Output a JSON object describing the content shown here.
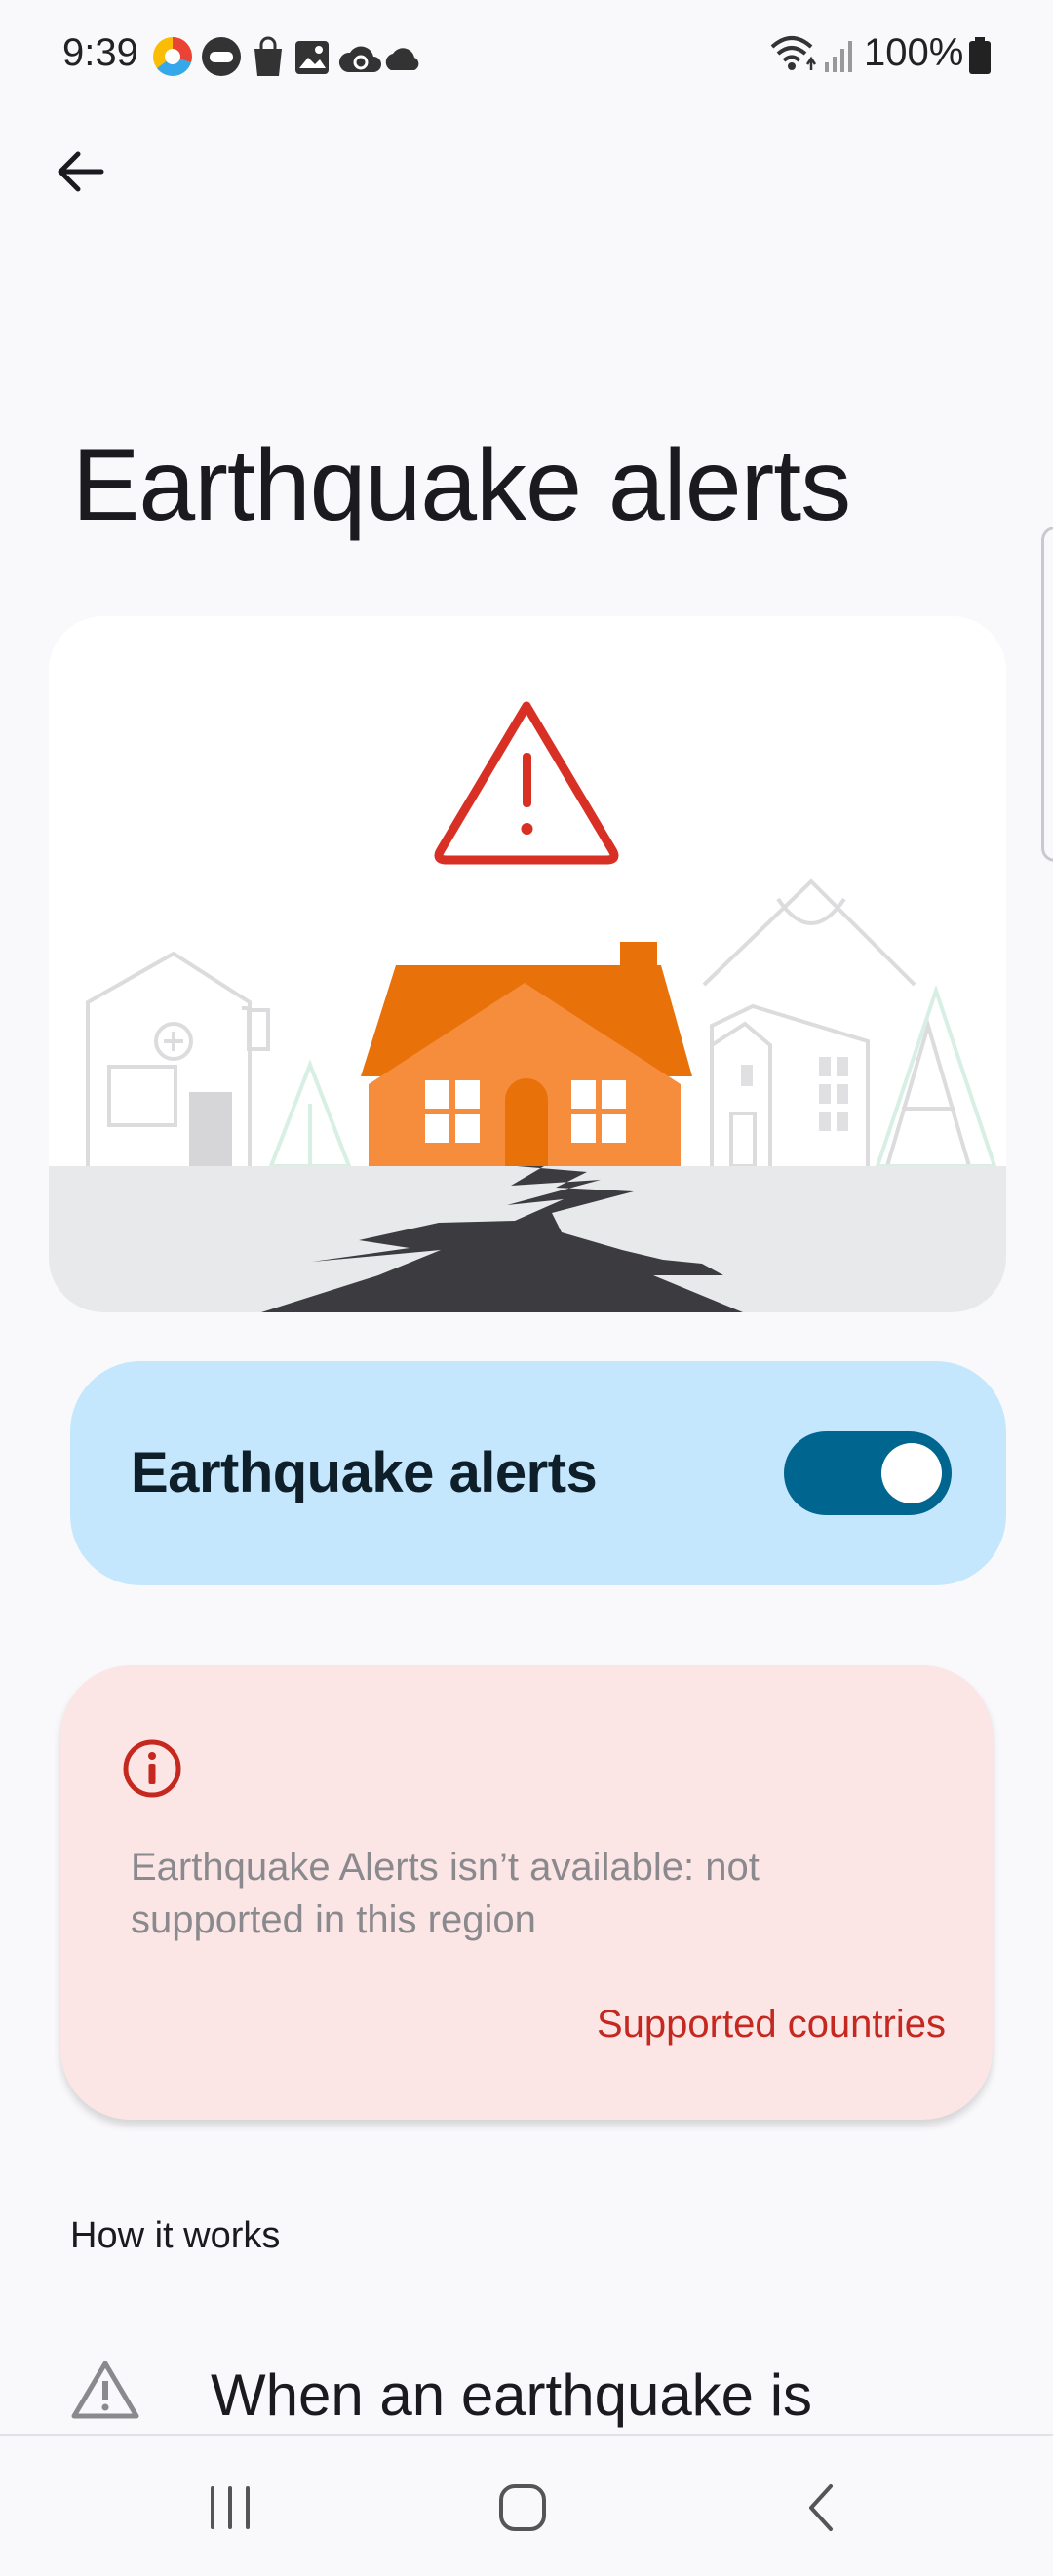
{
  "status": {
    "time": "9:39",
    "battery": "100%"
  },
  "nav": {
    "back_icon": "arrow-back-icon"
  },
  "page": {
    "title": "Earthquake alerts"
  },
  "illustration": {
    "alert_icon": "warning-triangle-icon",
    "colors": {
      "roof": "#e8710a",
      "walls": "#f68d3c",
      "ground": "#e8e9eb",
      "crack": "#3c3c40",
      "alert": "#d93025"
    }
  },
  "toggle": {
    "label": "Earthquake alerts",
    "enabled": true,
    "colors": {
      "card": "#c4e7fd",
      "track": "#00658f"
    }
  },
  "warning": {
    "icon": "info-circle-icon",
    "message": "Earthquake Alerts isn’t available: not supported in this region",
    "link": "Supported countries",
    "colors": {
      "card": "#fbe5e5",
      "link": "#c4281f"
    }
  },
  "how_it_works": {
    "heading": "How it works",
    "first_item_icon": "warning-outline-icon",
    "first_item_text": "When an earthquake is"
  },
  "system_nav": {
    "recents_icon": "recents-icon",
    "home_icon": "home-icon",
    "back_icon": "system-back-icon"
  }
}
